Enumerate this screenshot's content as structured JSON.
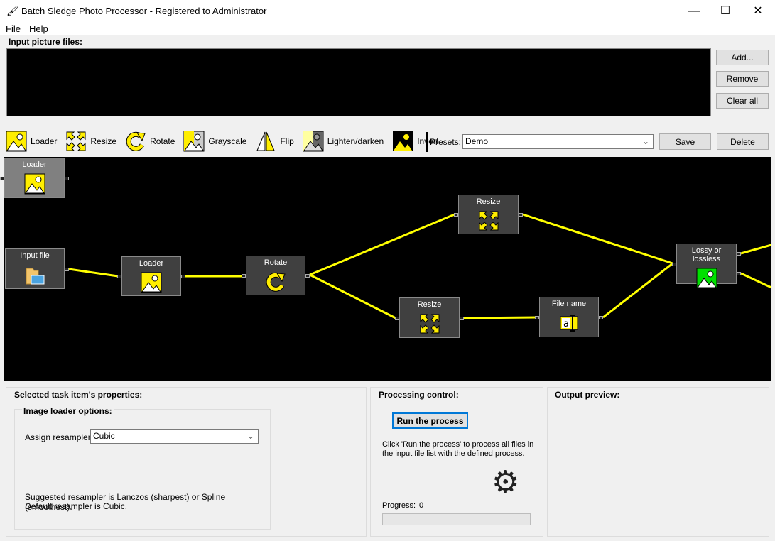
{
  "window": {
    "title": "Batch Sledge Photo Processor - Registered to Administrator",
    "minimize": "—",
    "maximize": "☐",
    "close": "✕"
  },
  "menu": [
    "File",
    "Help"
  ],
  "input_files": {
    "label": "Input picture files:",
    "add": "Add...",
    "remove": "Remove",
    "clear_all": "Clear all"
  },
  "toolbar": {
    "tools": [
      {
        "label": "Loader",
        "icon": "loader-icon"
      },
      {
        "label": "Resize",
        "icon": "resize-icon"
      },
      {
        "label": "Rotate",
        "icon": "rotate-icon"
      },
      {
        "label": "Grayscale",
        "icon": "grayscale-icon"
      },
      {
        "label": "Flip",
        "icon": "flip-icon"
      },
      {
        "label": "Lighten/darken",
        "icon": "lighten-darken-icon"
      },
      {
        "label": "Invert",
        "icon": "invert-icon"
      }
    ],
    "presets_label": "Presets:",
    "preset_value": "Demo",
    "save": "Save",
    "delete": "Delete"
  },
  "graph": {
    "nodes": [
      {
        "title": "Loader",
        "icon": "loader-icon",
        "selected": true
      },
      {
        "title": "Input file",
        "icon": "folder-icon"
      },
      {
        "title": "Loader",
        "icon": "loader-icon"
      },
      {
        "title": "Rotate",
        "icon": "rotate-icon"
      },
      {
        "title": "Resize",
        "icon": "resize-icon"
      },
      {
        "title": "Resize",
        "icon": "resize-icon"
      },
      {
        "title": "File name",
        "icon": "file-name-icon"
      },
      {
        "title": "Lossy or lossless",
        "icon": "lossy-lossless-icon"
      }
    ],
    "link_color": "#ffff00"
  },
  "properties": {
    "title": "Selected task item's properties:",
    "group": "Image loader options:",
    "resampler_label": "Assign resampler:",
    "resampler_value": "Cubic",
    "hint1": "Suggested resampler is Lanczos (sharpest) or Spline (smoothest).",
    "hint2": "Default resampler is Cubic."
  },
  "processing": {
    "title": "Processing control:",
    "run": "Run the process",
    "desc": "Click 'Run the process' to process all files in the input file list with the defined process.",
    "progress_label": "Progress:",
    "progress_value": "0",
    "progress_fraction": 0
  },
  "preview": {
    "title": "Output preview:"
  }
}
